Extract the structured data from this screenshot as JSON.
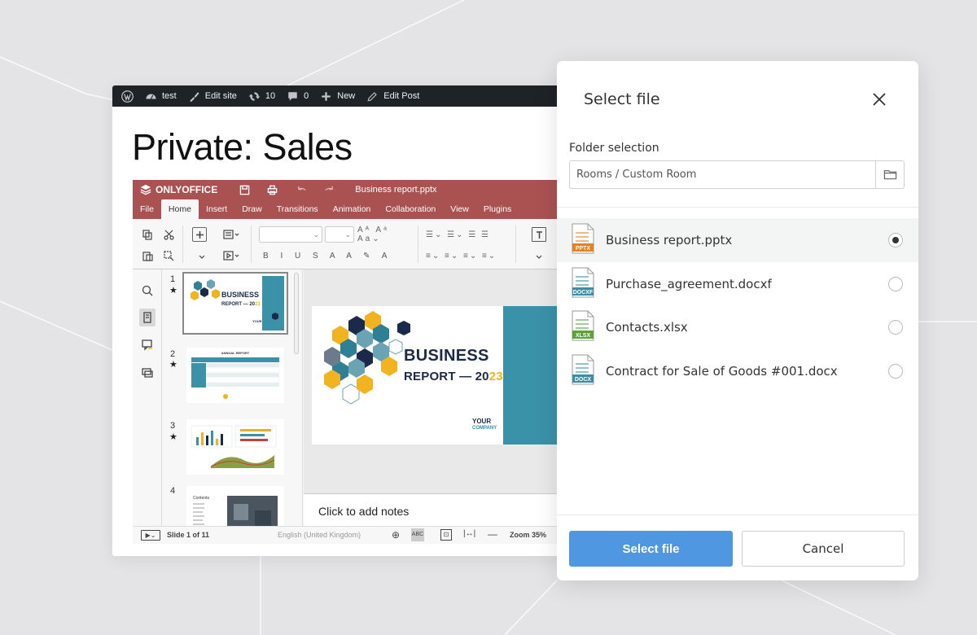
{
  "wp": {
    "admin_bar": {
      "site_name": "test",
      "edit_site": "Edit site",
      "updates_count": "10",
      "comments_count": "0",
      "new_label": "New",
      "edit_post": "Edit Post"
    },
    "page_title": "Private: Sales"
  },
  "editor": {
    "brand": "ONLYOFFICE",
    "doc_title": "Business report.pptx",
    "tabs": [
      "File",
      "Home",
      "Insert",
      "Draw",
      "Transitions",
      "Animation",
      "Collaboration",
      "View",
      "Plugins"
    ],
    "active_tab": "Home",
    "slide_numbers": [
      "1",
      "2",
      "3",
      "4"
    ],
    "slide": {
      "title_line1": "BUSINESS",
      "title_line2_prefix": "REPORT — 20",
      "title_line2_suffix": "23",
      "company_line1": "YOUR",
      "company_line2": "COMPANY"
    },
    "thumb2_header": "ANNUAL REPORT",
    "thumb4_title": "Contents",
    "notes_placeholder": "Click to add notes",
    "status": {
      "slide_info": "Slide 1 of 11",
      "language": "English (United Kingdom)",
      "zoom": "Zoom 35%"
    }
  },
  "dialog": {
    "title": "Select file",
    "folder_label": "Folder selection",
    "folder_value": "Rooms / Custom Room",
    "files": [
      {
        "name": "Business report.pptx",
        "ext": "PPTX",
        "color": "#e8801b",
        "selected": true
      },
      {
        "name": "Purchase_agreement.docxf",
        "ext": "DOCXF",
        "color": "#3b8ea5",
        "selected": false
      },
      {
        "name": "Contacts.xlsx",
        "ext": "XLSX",
        "color": "#5aa33a",
        "selected": false
      },
      {
        "name": "Contract for Sale of Goods #001.docx",
        "ext": "DOCX",
        "color": "#3b8ea5",
        "selected": false
      }
    ],
    "primary_button": "Select file",
    "secondary_button": "Cancel"
  },
  "colors": {
    "accent": "#4f97e1",
    "editor_brand": "#aa5252",
    "slide_teal": "#3a92a8",
    "slide_yellow": "#f2b320",
    "wp_admin_bar": "#1d2327"
  }
}
